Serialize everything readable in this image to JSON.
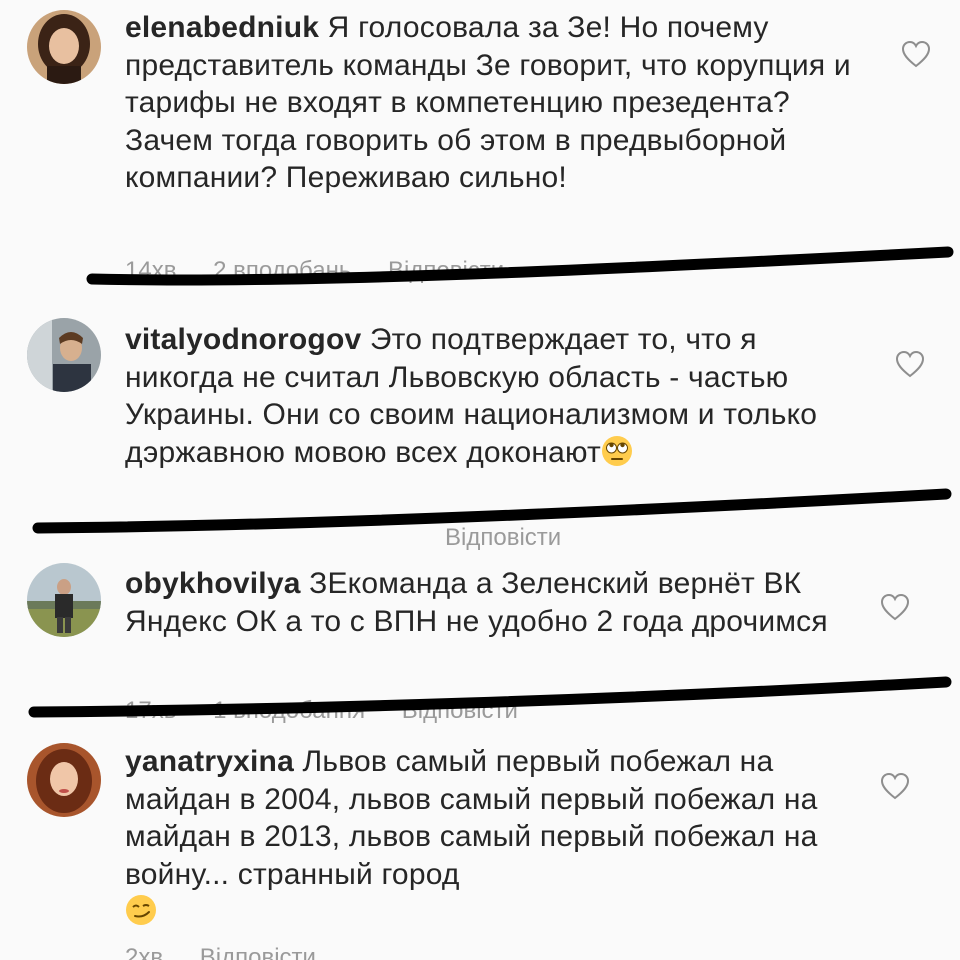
{
  "comments": [
    {
      "username": "elenabedniuk",
      "text": "Я голосовала за Зе! Но почему представитель команды Зе говорит, что корупция и тарифы не входят в компетенцию презедента?  Зачем тогда говорить об этом в предвыборной компании? Переживаю сильно!",
      "time": "14хв",
      "likes": "2 вподобань",
      "reply": "Відповісти"
    },
    {
      "username": "vitalyodnorogov",
      "text": "Это подтверждает то, что я никогда не считал Львовскую область - частью Украины. Они со своим национализмом и только дэржавною мовою всех доконают",
      "emoji": "face-with-rolling-eyes",
      "reply": "Відповісти"
    },
    {
      "username": "obykhovilya",
      "text": "ЗЕкоманда а Зеленский вернёт ВК Яндекс ОК а то с ВПН не удобно 2 года дрочимся",
      "time": "17хв",
      "likes": "1 вподобання",
      "reply": "Відповісти"
    },
    {
      "username": "yanatryxina",
      "text": "Львов самый первый побежал на майдан в 2004, львов самый первый побежал на майдан в 2013, львов самый первый побежал на войну... странный город",
      "emoji": "smirking-face",
      "time": "2хв",
      "reply": "Відповісти"
    }
  ],
  "colors": {
    "background": "#fafafa",
    "text": "#262626",
    "meta": "#9a9a9a",
    "scribble": "#000000"
  }
}
